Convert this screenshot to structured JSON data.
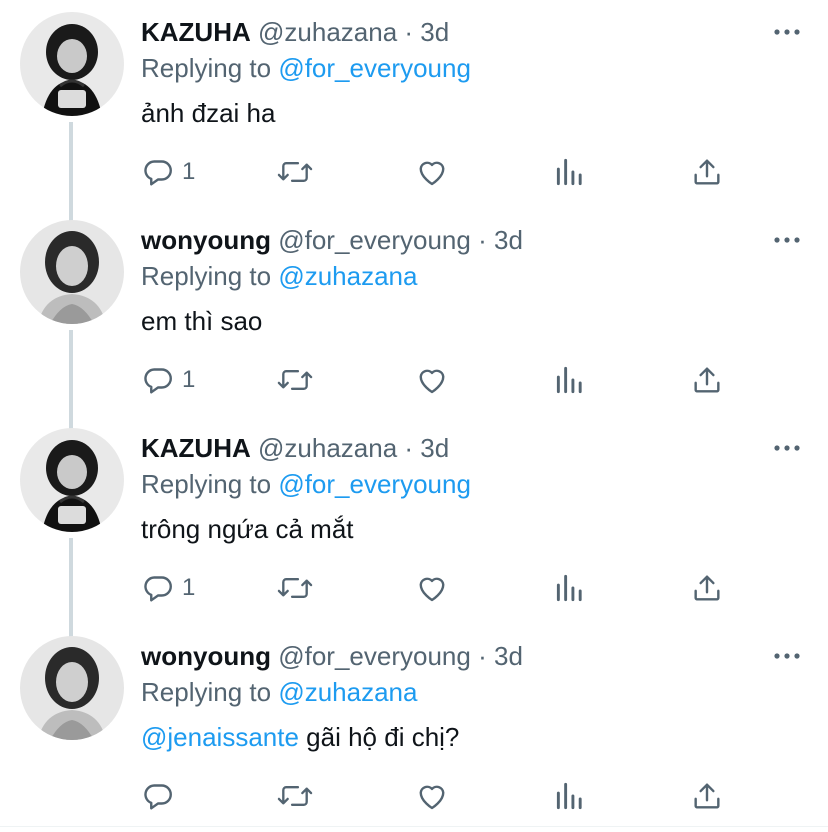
{
  "tweets": [
    {
      "name": "KAZUHA",
      "handle": "@zuhazana",
      "sep": "·",
      "time": "3d",
      "replying_prefix": "Replying to",
      "replying_to": "@for_everyoung",
      "text": "ảnh đzai ha",
      "mention": "",
      "reply_count": "1"
    },
    {
      "name": "wonyoung",
      "handle": "@for_everyoung",
      "sep": "·",
      "time": "3d",
      "replying_prefix": "Replying to",
      "replying_to": "@zuhazana",
      "text": "em thì sao",
      "mention": "",
      "reply_count": "1"
    },
    {
      "name": "KAZUHA",
      "handle": "@zuhazana",
      "sep": "·",
      "time": "3d",
      "replying_prefix": "Replying to",
      "replying_to": "@for_everyoung",
      "text": "trông ngứa cả mắt",
      "mention": "",
      "reply_count": "1"
    },
    {
      "name": "wonyoung",
      "handle": "@for_everyoung",
      "sep": "·",
      "time": "3d",
      "replying_prefix": "Replying to",
      "replying_to": "@zuhazana",
      "text": "gãi hộ đi chị?",
      "mention": "@jenaissante",
      "reply_count": ""
    }
  ],
  "colors": {
    "text": "#0f1419",
    "muted": "#536471",
    "link": "#1d9bf0",
    "thread_line": "#cfd9de"
  },
  "icons": [
    "more-icon",
    "reply-icon",
    "retweet-icon",
    "like-icon",
    "analytics-icon",
    "share-icon"
  ]
}
